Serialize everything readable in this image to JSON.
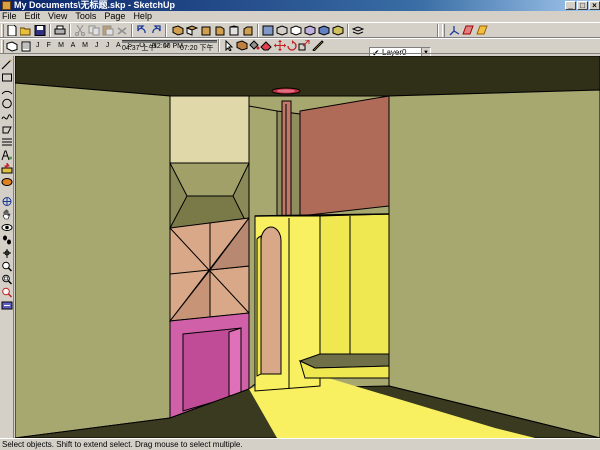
{
  "window": {
    "title": "My Documents\\无标题.skp - SketchUp",
    "minimize_glyph": "_",
    "maximize_glyph": "□",
    "close_glyph": "×"
  },
  "menu": {
    "file": "File",
    "edit": "Edit",
    "view": "View",
    "tools": "Tools",
    "page": "Page",
    "help": "Help"
  },
  "shadow_toolbar": {
    "months": "J F M A M J J A S O N D",
    "time_start": "04:37 上午",
    "time_noon": "12:00 PM",
    "time_end": "07:20 下午"
  },
  "layers": {
    "current_layer": "Layer0",
    "check_glyph": "✔",
    "drop_glyph": "▼"
  },
  "status": {
    "message": "Select objects. Shift to extend select. Drag mouse to select multiple."
  },
  "icons": {
    "file_toolbar": [
      "new-icon",
      "open-icon",
      "save-icon",
      "print-icon",
      "cut-icon",
      "copy-icon",
      "paste-icon",
      "erase-icon",
      "undo-icon",
      "redo-icon"
    ],
    "view_toolbar": [
      "iso-view-icon",
      "top-view-icon",
      "front-view-icon",
      "right-view-icon",
      "back-view-icon",
      "left-view-icon"
    ],
    "left_toolbar": [
      "select-icon",
      "line-icon",
      "rectangle-icon",
      "arc-icon",
      "circle-icon",
      "freehand-icon",
      "eraser-icon",
      "push-pull-icon",
      "measure-icon",
      "orbit-icon",
      "pan-icon",
      "zoom-icon"
    ]
  },
  "colors": {
    "title_bar": "#0a246a",
    "wall_olive": "#a7a770",
    "wall_yellow": "#f8f060",
    "wall_magenta": "#d060a8",
    "wall_brown": "#b06a58",
    "floor_dark": "#3a3a20",
    "ceiling_dark": "#303018"
  }
}
